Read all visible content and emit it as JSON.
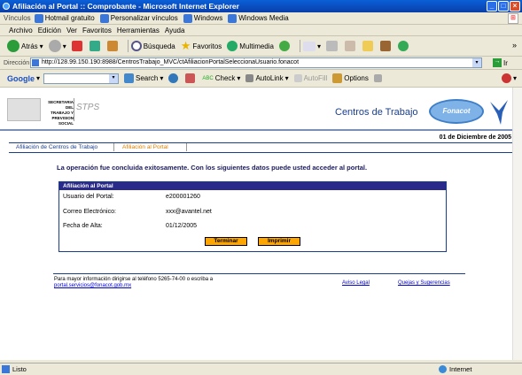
{
  "window": {
    "title": "Afiliación al Portal :: Comprobante - Microsoft Internet Explorer"
  },
  "links_bar": {
    "label": "Vínculos",
    "items": [
      "Hotmail gratuito",
      "Personalizar vínculos",
      "Windows",
      "Windows Media"
    ]
  },
  "menu": {
    "items": [
      "Archivo",
      "Edición",
      "Ver",
      "Favoritos",
      "Herramientas",
      "Ayuda"
    ]
  },
  "toolbar": {
    "back": "Atrás",
    "search": "Búsqueda",
    "favorites": "Favoritos",
    "multimedia": "Multimedia"
  },
  "address": {
    "label": "Dirección",
    "url": "http://128.99.150.190:8988/CentrosTrabajo_MVC/ctAfiliacionPortalSeleccionaUsuario.fonacot",
    "go": "Ir"
  },
  "google_bar": {
    "logo": "Google",
    "search": "Search",
    "check": "Check",
    "autolink": "AutoLink",
    "autofill": "AutoFill",
    "options": "Options"
  },
  "header": {
    "ministry_lines": [
      "SECRETARIA DEL",
      "TRABAJO Y",
      "PREVISION SOCIAL"
    ],
    "stps": "STPS",
    "title": "Centros de Trabajo",
    "logo": "Fonacot",
    "date": "01 de Diciembre de 2005"
  },
  "breadcrumb": {
    "tab1": "Afiliación de Centros de Trabajo",
    "tab2": "Afiliación al Portal"
  },
  "main": {
    "message": "La operación fue concluida exitosamente. Con los siguientes datos puede usted acceder al portal.",
    "box_title": "Afiliación al Portal",
    "rows": [
      {
        "label": "Usuario del Portal:",
        "value": "e200001260"
      },
      {
        "label": "Correo Electrónico:",
        "value": "xxx@avantel.net"
      },
      {
        "label": "Fecha de Alta:",
        "value": "01/12/2005"
      }
    ],
    "buttons": {
      "finish": "Terminar",
      "print": "Imprimir"
    }
  },
  "footer": {
    "info": "Para mayor información dirigirse al teléfono 5265-74-00 o escriba a",
    "email": "portal.servicios@fonacot.gob.mx",
    "legal": "Aviso Legal",
    "complaints": "Quejas y Sugerencias"
  },
  "statusbar": {
    "text": "Listo",
    "zone": "Internet"
  }
}
